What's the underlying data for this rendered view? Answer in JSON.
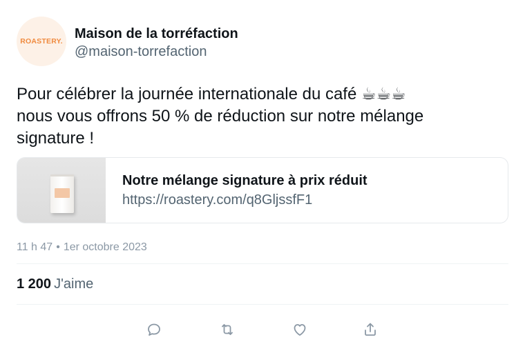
{
  "author": {
    "avatar_text": "ROASTERY.",
    "display_name": "Maison de la torréfaction",
    "handle": "@maison-torrefaction"
  },
  "tweet": {
    "lines": [
      "Pour célébrer la journée internationale du café ☕☕☕",
      "nous vous offrons 50 % de réduction sur notre mélange",
      "signature !"
    ]
  },
  "link_card": {
    "title": "Notre mélange signature à prix réduit",
    "url": "https://roastery.com/q8GljssfF1"
  },
  "meta": {
    "time": "11 h 47",
    "separator": "•",
    "date": "1er octobre 2023"
  },
  "stats": {
    "likes_count": "1 200",
    "likes_label": "J'aime"
  },
  "actions": [
    {
      "icon": "reply-icon"
    },
    {
      "icon": "retweet-icon"
    },
    {
      "icon": "like-icon"
    },
    {
      "icon": "share-icon"
    }
  ],
  "colors": {
    "text_primary": "#0f1419",
    "text_secondary": "#536471",
    "text_muted": "#8b98a5",
    "border": "#e6e9ec",
    "brand_orange": "#f08a3e",
    "avatar_bg": "#fdf1e7"
  }
}
